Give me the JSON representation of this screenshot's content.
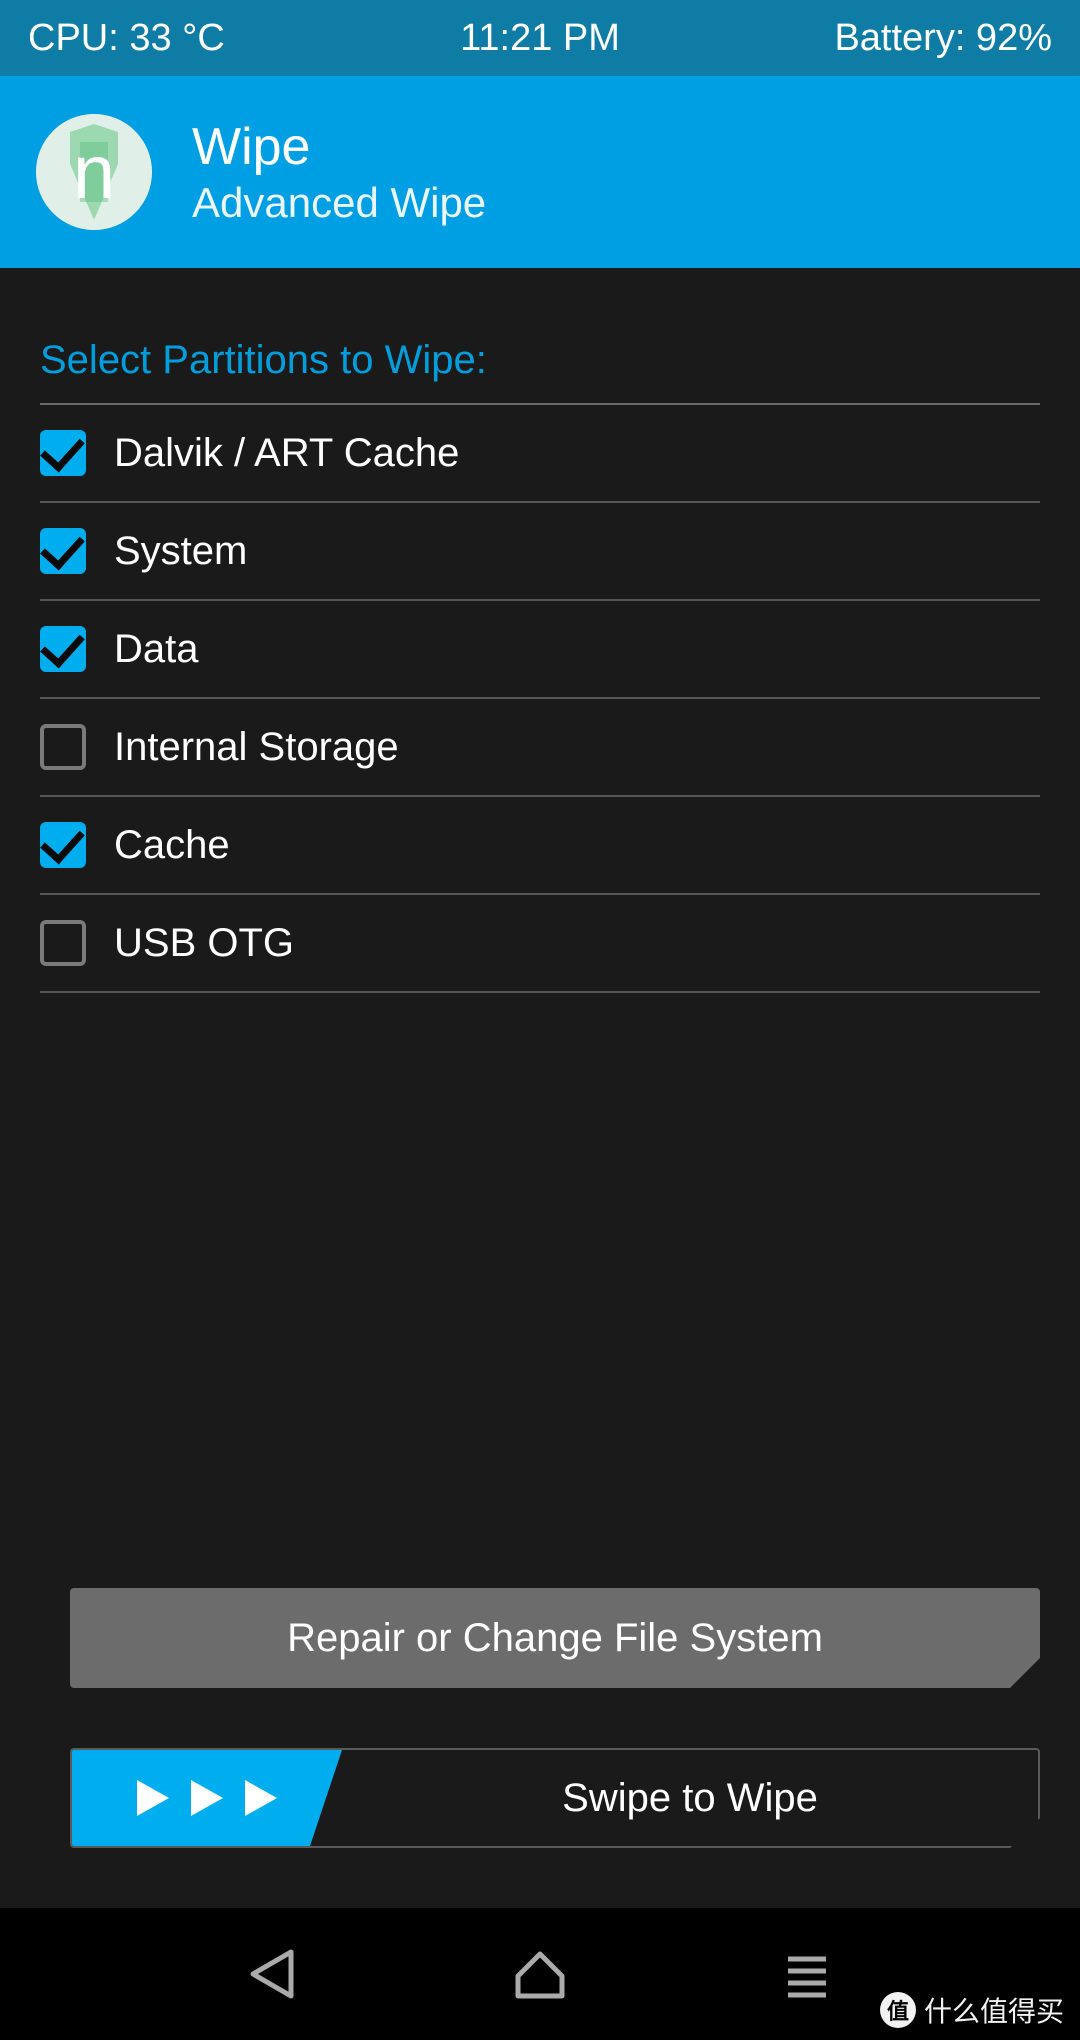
{
  "status_bar": {
    "cpu": "CPU: 33 °C",
    "time": "11:21 PM",
    "battery": "Battery: 92%"
  },
  "header": {
    "title": "Wipe",
    "subtitle": "Advanced Wipe",
    "icon_letter": "n"
  },
  "section_label": "Select Partitions to Wipe:",
  "partitions": [
    {
      "label": "Dalvik / ART Cache",
      "checked": true
    },
    {
      "label": "System",
      "checked": true
    },
    {
      "label": "Data",
      "checked": true
    },
    {
      "label": "Internal Storage",
      "checked": false
    },
    {
      "label": "Cache",
      "checked": true
    },
    {
      "label": "USB OTG",
      "checked": false
    }
  ],
  "buttons": {
    "repair": "Repair or Change File System",
    "swipe": "Swipe to Wipe"
  },
  "watermark": {
    "badge": "值",
    "text": "什么值得买"
  },
  "colors": {
    "accent": "#00aeef",
    "header_dark": "#0f7ca6",
    "header_light": "#009fe3",
    "bg": "#1a1a1a",
    "button_gray": "#6c6c6c"
  }
}
